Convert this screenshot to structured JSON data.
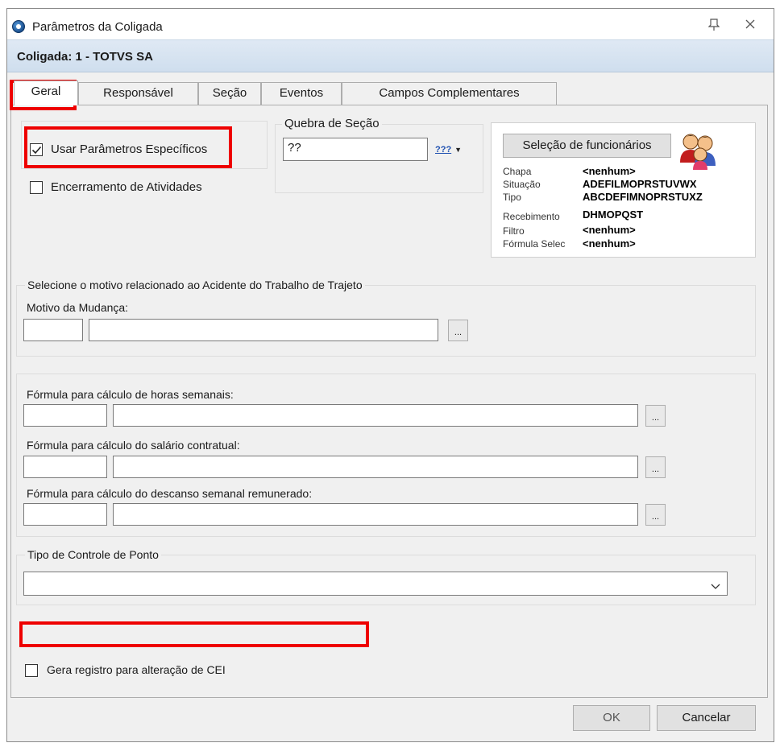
{
  "window": {
    "title": "Parâmetros da Coligada"
  },
  "header": {
    "coligada": "Coligada: 1 - TOTVS SA"
  },
  "tabs": [
    {
      "label": "Geral"
    },
    {
      "label": "Responsável"
    },
    {
      "label": "Seção"
    },
    {
      "label": "Eventos"
    },
    {
      "label": "Campos Complementares"
    }
  ],
  "geral": {
    "usar_parametros": {
      "label": "Usar Parâmetros Específicos",
      "checked": true
    },
    "encerramento": {
      "label": "Encerramento de Atividades",
      "checked": false
    },
    "quebra_secao": {
      "legend": "Quebra de Seção",
      "value": "??",
      "picker_label": "???"
    },
    "selecao": {
      "button": "Seleção de funcionários",
      "rows": [
        {
          "key": "Chapa",
          "value": "<nenhum>"
        },
        {
          "key": "Situação",
          "value": "ADEFILMOPRSTUVWX"
        },
        {
          "key": "Tipo",
          "value": "ABCDEFIMNOPRSTUXZ"
        },
        {
          "key": "Recebimento",
          "value": "DHMOPQST"
        },
        {
          "key": "Filtro",
          "value": "<nenhum>"
        },
        {
          "key": "Fórmula Selec",
          "value": "<nenhum>"
        }
      ]
    },
    "acidente": {
      "legend": "Selecione o motivo relacionado ao Acidente do Trabalho de Trajeto",
      "motivo_label": "Motivo da Mudança:",
      "code": "",
      "desc": ""
    },
    "formulas": [
      {
        "label": "Fórmula para cálculo de horas semanais:",
        "code": "",
        "desc": ""
      },
      {
        "label": "Fórmula para cálculo do salário contratual:",
        "code": "",
        "desc": ""
      },
      {
        "label": "Fórmula para cálculo do descanso semanal remunerado:",
        "code": "",
        "desc": ""
      }
    ],
    "controle_ponto": {
      "legend": "Tipo de Controle de Ponto",
      "value": ""
    },
    "gera_registro": {
      "label": "Gera registro para alteração de CEI",
      "checked": false
    }
  },
  "dots_label": "...",
  "footer": {
    "ok": "OK",
    "cancel": "Cancelar"
  },
  "colors": {
    "highlight": "#ee0000",
    "header_bar": "#dfe9f4"
  }
}
